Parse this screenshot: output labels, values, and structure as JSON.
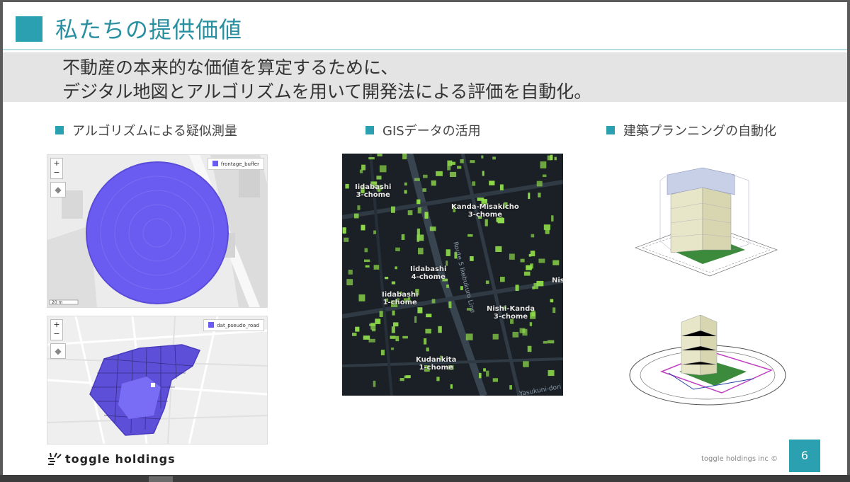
{
  "title": "私たちの提供価値",
  "subtitle": {
    "line1": "不動産の本来的な価値を算定するために、",
    "line2": "デジタル地図とアルゴリズムを用いて開発法による評価を自動化。"
  },
  "sections": [
    {
      "label": "アルゴリズムによる疑似測量"
    },
    {
      "label": "GISデータの活用"
    },
    {
      "label": "建築プランニングの自動化"
    }
  ],
  "map1": {
    "zoom_in": "+",
    "zoom_out": "−",
    "legend": "frontage_buffer",
    "scale": "20 m"
  },
  "map2": {
    "zoom_in": "+",
    "zoom_out": "−",
    "legend": "dat_pseudo_road"
  },
  "gis_labels": [
    {
      "text": "Iidabashi\n3-chome"
    },
    {
      "text": "Kanda-Misakicho\n3-chome"
    },
    {
      "text": "Iidabashi\n4-chome"
    },
    {
      "text": "Iidabashi\n1-chome"
    },
    {
      "text": "Nishi-Kanda\n3-chome"
    },
    {
      "text": "Kudankita\n1-chome"
    },
    {
      "text": "Nishi"
    }
  ],
  "gis_roads": [
    "Route 5 Ikebukuro Line",
    "Yasukuni-dori"
  ],
  "footer": {
    "brand": "toggle holdings",
    "copyright": "toggle holdings inc ©",
    "page": "6"
  },
  "colors": {
    "accent": "#2aa0b0",
    "map_fill": "#6a5cf0",
    "gis_building": "#8fdc4a"
  }
}
